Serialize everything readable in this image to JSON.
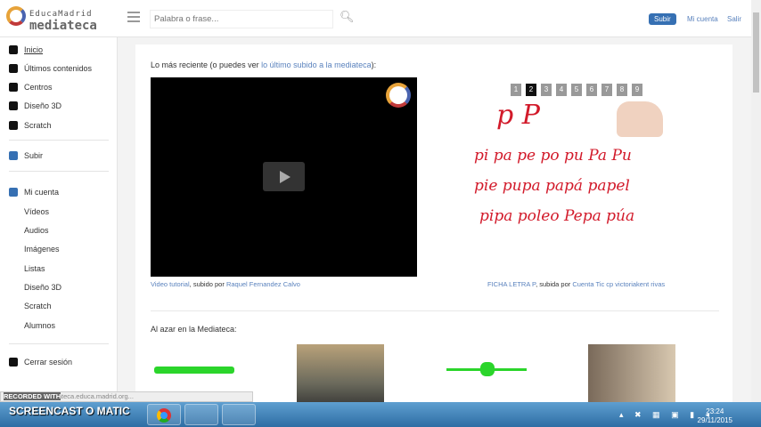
{
  "header": {
    "brand_top": "EducaMadrid",
    "brand_bottom": "mediateca",
    "search_placeholder": "Palabra o frase...",
    "subir": "Subir",
    "mi_cuenta": "Mi cuenta",
    "salir": "Salir"
  },
  "sidebar": {
    "items": [
      {
        "label": "Inicio"
      },
      {
        "label": "Últimos contenidos"
      },
      {
        "label": "Centros"
      },
      {
        "label": "Diseño 3D"
      },
      {
        "label": "Scratch"
      },
      {
        "label": "Subir"
      },
      {
        "label": "Mi cuenta"
      }
    ],
    "sub_items": [
      "Vídeos",
      "Audios",
      "Imágenes",
      "Listas",
      "Diseño 3D",
      "Scratch",
      "Alumnos"
    ],
    "logout": "Cerrar sesión"
  },
  "main": {
    "recent_prefix": "Lo más reciente (o puedes ver ",
    "recent_link": "lo último subido a la mediateca",
    "recent_suffix": "):",
    "video_title": "Video tutorial",
    "video_by": ", subido por ",
    "video_author": "Raquel Fernandez Calvo",
    "pages": [
      "1",
      "2",
      "3",
      "4",
      "5",
      "6",
      "7",
      "8",
      "9"
    ],
    "active_page": "2",
    "sheet_lines": [
      "p P",
      "pi pa pe po pu Pa Pu",
      "pie pupa papá papel",
      "pipa poleo Pepa púa"
    ],
    "img_title": "FICHA LETRA P",
    "img_by": ", subida por ",
    "img_author": "Cuenta Tic cp victoriakent rivas",
    "random_title": "Al azar en la Mediateca:"
  },
  "status_bar": "Esperando a mediateca.educa.madrid.org...",
  "taskbar": {
    "watermark": "SCREENCAST O MATIC",
    "recorded": "RECORDED WITH",
    "time": "23:24",
    "date": "29/11/2015"
  }
}
